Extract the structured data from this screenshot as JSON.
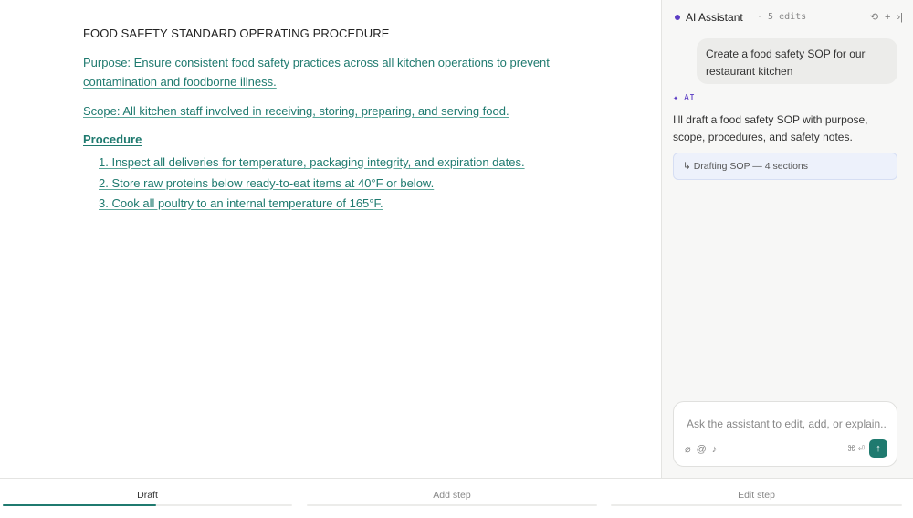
{
  "document": {
    "title": "FOOD SAFETY STANDARD OPERATING PROCEDURE",
    "purpose": "Purpose: Ensure consistent food safety practices across all kitchen operations to prevent contamination and foodborne illness.",
    "scope": "Scope: All kitchen staff involved in receiving, storing, preparing, and serving food.",
    "procedure_heading": "Procedure",
    "steps": [
      "1. Inspect all deliveries for temperature, packaging integrity, and expiration dates.",
      "2. Store raw proteins below ready-to-eat items at 40°F or below.",
      "3. Cook all poultry to an internal temperature of 165°F."
    ]
  },
  "sidebar": {
    "title": "AI Assistant",
    "edits": "· 5 edits",
    "icons": [
      "history-icon",
      "plus-icon",
      "collapse-icon"
    ],
    "user_message": "Create a food safety SOP for our restaurant kitchen",
    "ai_label": "✦ AI",
    "ai_message": "I'll draft a food safety SOP with purpose, scope, procedures, and safety notes.",
    "ai_chip": "↳ Drafting SOP — 4 sections",
    "composer": {
      "placeholder": "Ask the assistant to edit, add, or explain...",
      "shortcut": "⌘ ⏎",
      "send_icon": "↑"
    }
  },
  "tabs": [
    {
      "label": "Draft",
      "progress": 0.53,
      "active": true
    },
    {
      "label": "Add step",
      "progress": 0,
      "active": false
    },
    {
      "label": "Edit step",
      "progress": 0,
      "active": false
    }
  ],
  "colors": {
    "accent": "#1f7a6f",
    "ai": "#5b3cc4"
  }
}
